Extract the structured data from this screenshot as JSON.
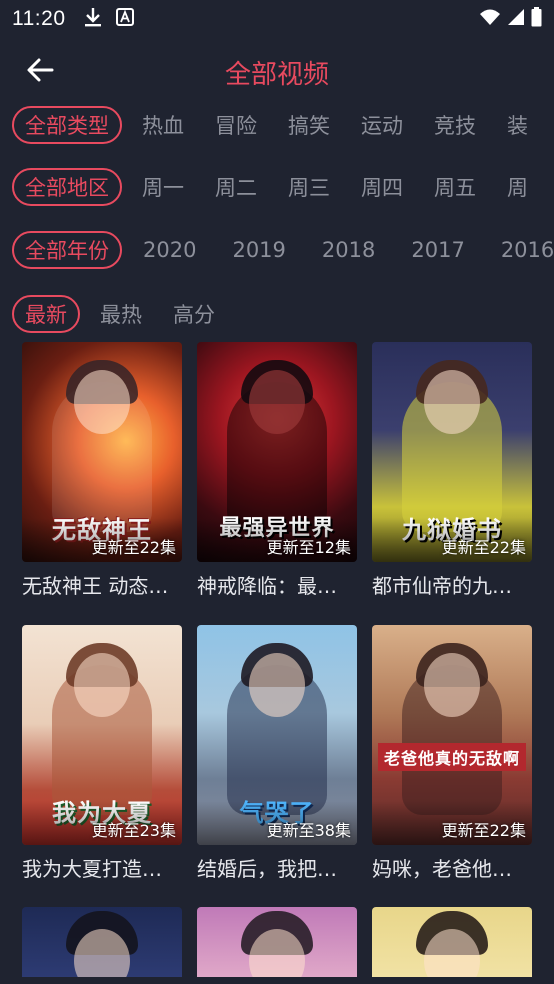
{
  "status": {
    "time": "11:20",
    "icons": [
      "download-icon",
      "a-app-icon"
    ],
    "right_icons": [
      "wifi-icon",
      "signal-icon",
      "battery-icon"
    ]
  },
  "header": {
    "title": "全部视频",
    "back_icon": "arrow-left-icon"
  },
  "colors": {
    "accent": "#e84a5f",
    "background": "#1f2330",
    "inactive": "#8d909b"
  },
  "filters": {
    "type": {
      "all": "全部类型",
      "options": [
        "热血",
        "冒险",
        "搞笑",
        "运动",
        "竞技",
        "装"
      ]
    },
    "region": {
      "all": "全部地区",
      "options": [
        "周一",
        "周二",
        "周三",
        "周四",
        "周五",
        "周"
      ]
    },
    "year": {
      "all": "全部年份",
      "options": [
        "2020",
        "2019",
        "2018",
        "2017",
        "2016"
      ]
    },
    "sort": {
      "active": "最新",
      "options": [
        "最热",
        "高分"
      ]
    }
  },
  "videos": [
    {
      "title": "无敌神王 动态…",
      "episode": "更新至22集",
      "cover_text": "无敌神王"
    },
    {
      "title": "神戒降临：最…",
      "episode": "更新至12集",
      "cover_text": "最强异世界"
    },
    {
      "title": "都市仙帝的九…",
      "episode": "更新至22集",
      "cover_text": "九狱婚书"
    },
    {
      "title": "我为大夏打造…",
      "episode": "更新至23集",
      "cover_text": "我为大夏"
    },
    {
      "title": "结婚后，我把…",
      "episode": "更新至38集",
      "cover_text": "气哭了"
    },
    {
      "title": "妈咪，老爸他…",
      "episode": "更新至22集",
      "cover_text": "老爸他真的无敌啊"
    },
    {
      "title": "",
      "episode": "",
      "cover_text": ""
    },
    {
      "title": "",
      "episode": "",
      "cover_text": ""
    },
    {
      "title": "",
      "episode": "",
      "cover_text": ""
    }
  ]
}
